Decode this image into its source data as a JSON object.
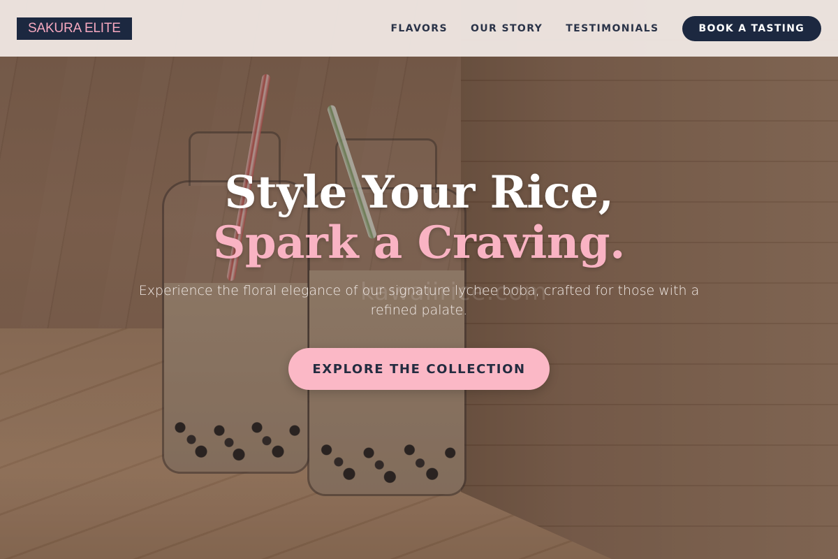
{
  "brand": {
    "logo_text": "SAKURA ELITE"
  },
  "nav": {
    "items": [
      {
        "label": "FLAVORS"
      },
      {
        "label": "OUR STORY"
      },
      {
        "label": "TESTIMONIALS"
      }
    ],
    "cta_label": "BOOK A TASTING"
  },
  "hero": {
    "headline_line1": "Style Your Rice,",
    "headline_line2": "Spark a Craving.",
    "subtitle": "Experience the floral elegance of our signature lychee boba, crafted for those with a refined palate.",
    "cta_label": "EXPLORE THE COLLECTION",
    "watermark": "kawaiirice.com"
  },
  "colors": {
    "navy": "#1c2840",
    "pink": "#f9b3c3",
    "header_bg": "#f0e8e4"
  }
}
